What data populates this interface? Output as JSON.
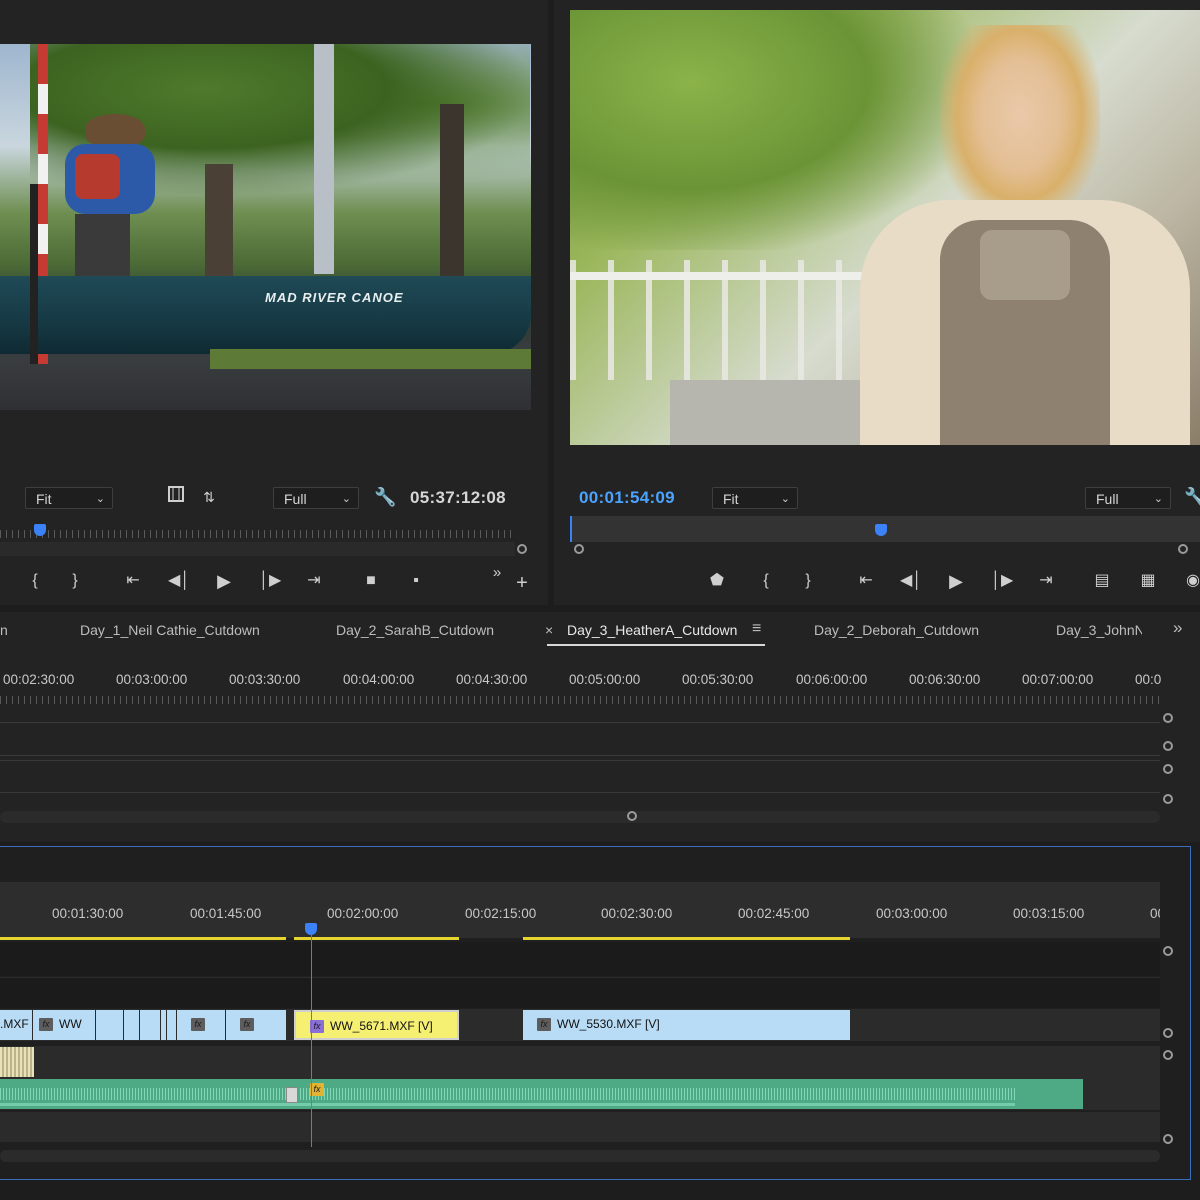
{
  "source_monitor": {
    "zoom": "Fit",
    "resolution": "Full",
    "timecode": "05:37:12:08",
    "canoe_text": "MAD RIVER CANOE"
  },
  "program_monitor": {
    "timecode": "00:01:54:09",
    "zoom": "Fit",
    "resolution": "Full"
  },
  "sequence_tabs": [
    {
      "label": "n"
    },
    {
      "label": "Day_1_Neil Cathie_Cutdown"
    },
    {
      "label": "Day_2_SarahB_Cutdown"
    },
    {
      "label": "Day_3_HeatherA_Cutdown"
    },
    {
      "label": "Day_2_Deborah_Cutdown"
    },
    {
      "label": "Day_3_JohnN"
    }
  ],
  "active_tab_close": "×",
  "tab_menu_icon": "≡",
  "tab_overflow": "»",
  "upper_ruler": [
    "00:02:30:00",
    "00:03:00:00",
    "00:03:30:00",
    "00:04:00:00",
    "00:04:30:00",
    "00:05:00:00",
    "00:05:30:00",
    "00:06:00:00",
    "00:06:30:00",
    "00:07:00:00",
    "00:0"
  ],
  "lower_ruler": [
    "00:01:30:00",
    "00:01:45:00",
    "00:02:00:00",
    "00:02:15:00",
    "00:02:30:00",
    "00:02:45:00",
    "00:03:00:00",
    "00:03:15:00",
    "00"
  ],
  "clips": {
    "c1": ".MXF",
    "c2": "WW",
    "c3": "WW_5671.MXF [V]",
    "c4": "WW_5530.MXF [V]",
    "fx": "fx"
  },
  "colors": {
    "accent_blue": "#3b82f6",
    "timecode_blue": "#4aa3ff",
    "clip_blue": "#b9dcf6",
    "clip_yellow": "#f5ef72",
    "audio_green": "#4daa85"
  }
}
